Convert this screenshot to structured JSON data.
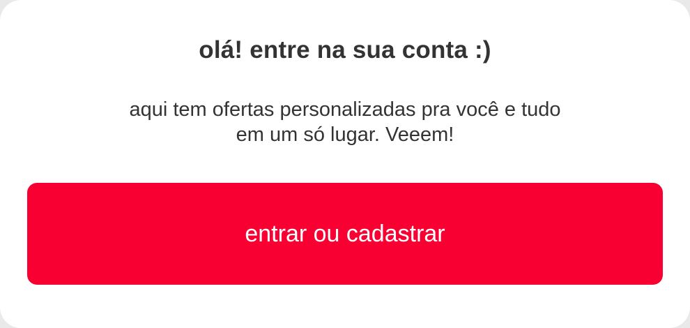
{
  "login_card": {
    "title": "olá! entre na sua conta :)",
    "subtitle_line1": "aqui tem ofertas personalizadas pra você e tudo",
    "subtitle_line2": "em um só lugar. Veeem!",
    "cta_label": "entrar ou cadastrar"
  },
  "colors": {
    "accent": "#f80032",
    "text": "#333333",
    "card_background": "#ffffff"
  }
}
